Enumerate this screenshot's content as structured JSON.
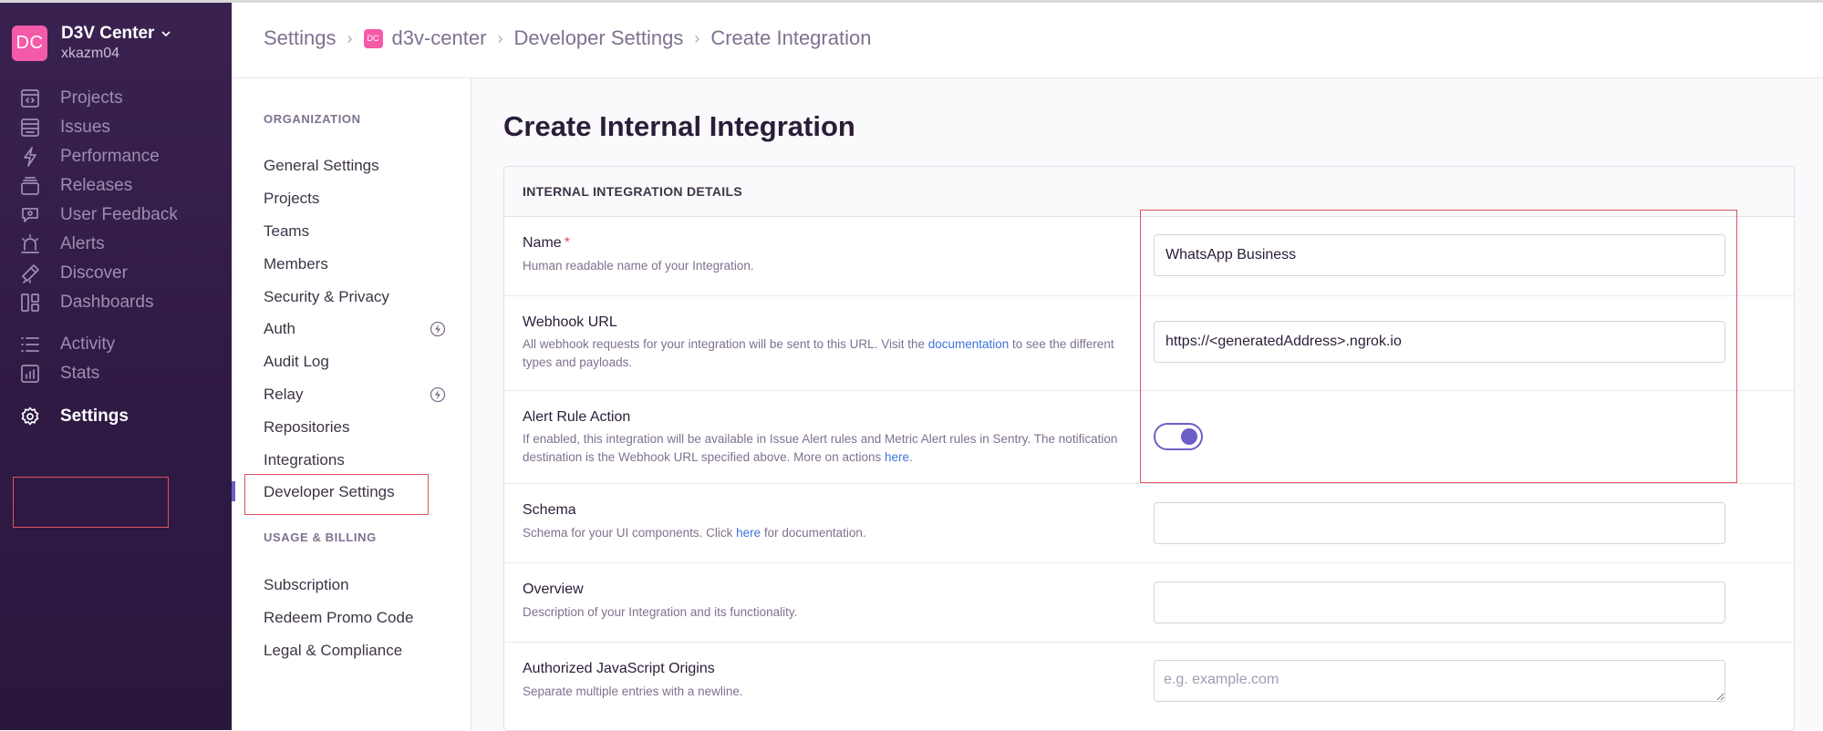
{
  "org": {
    "badge": "DC",
    "name": "D3V Center",
    "username": "xkazm04"
  },
  "nav": {
    "items": [
      {
        "label": "Projects",
        "icon": "projects-icon"
      },
      {
        "label": "Issues",
        "icon": "issues-icon"
      },
      {
        "label": "Performance",
        "icon": "performance-icon"
      },
      {
        "label": "Releases",
        "icon": "releases-icon"
      },
      {
        "label": "User Feedback",
        "icon": "user-feedback-icon"
      },
      {
        "label": "Alerts",
        "icon": "alerts-icon"
      },
      {
        "label": "Discover",
        "icon": "discover-icon"
      },
      {
        "label": "Dashboards",
        "icon": "dashboards-icon"
      },
      {
        "label": "Activity",
        "icon": "activity-icon"
      },
      {
        "label": "Stats",
        "icon": "stats-icon"
      },
      {
        "label": "Settings",
        "icon": "settings-icon"
      }
    ],
    "active": "Settings"
  },
  "breadcrumb": {
    "items": [
      "Settings",
      "d3v-center",
      "Developer Settings",
      "Create Integration"
    ],
    "org_badge": "DC"
  },
  "settings_nav": {
    "organization_title": "ORGANIZATION",
    "organization_items": [
      "General Settings",
      "Projects",
      "Teams",
      "Members",
      "Security & Privacy",
      "Auth",
      "Audit Log",
      "Relay",
      "Repositories",
      "Integrations",
      "Developer Settings"
    ],
    "billing_title": "USAGE & BILLING",
    "billing_items": [
      "Subscription",
      "Redeem Promo Code",
      "Legal & Compliance"
    ],
    "active": "Developer Settings",
    "badged_items": [
      "Auth",
      "Relay"
    ],
    "badge_icon": "lightning-icon"
  },
  "page": {
    "title": "Create Internal Integration",
    "panel_title": "INTERNAL INTEGRATION DETAILS",
    "fields": {
      "name": {
        "label": "Name",
        "required_mark": "*",
        "help": "Human readable name of your Integration.",
        "value": "WhatsApp Business"
      },
      "webhook": {
        "label": "Webhook URL",
        "help_before": "All webhook requests for your integration will be sent to this URL. Visit the ",
        "help_link": "documentation",
        "help_after": " to see the different types and payloads.",
        "value": "https://<generatedAddress>.ngrok.io"
      },
      "alert_rule": {
        "label": "Alert Rule Action",
        "help_before": "If enabled, this integration will be available in Issue Alert rules and Metric Alert rules in Sentry. The notification destination is the Webhook URL specified above. More on actions ",
        "help_link": "here",
        "help_after": ".",
        "enabled": true
      },
      "schema": {
        "label": "Schema",
        "help_before": "Schema for your UI components. Click ",
        "help_link": "here",
        "help_after": " for documentation.",
        "value": ""
      },
      "overview": {
        "label": "Overview",
        "help": "Description of your Integration and its functionality.",
        "value": ""
      },
      "origins": {
        "label": "Authorized JavaScript Origins",
        "help": "Separate multiple entries with a newline.",
        "placeholder": "e.g. example.com",
        "value": ""
      }
    }
  },
  "colors": {
    "sidebar": "#3a2250",
    "accent": "#6c5fc7",
    "badge": "#f55aa9",
    "highlight_box": "#e0525e",
    "link": "#3d74db"
  }
}
